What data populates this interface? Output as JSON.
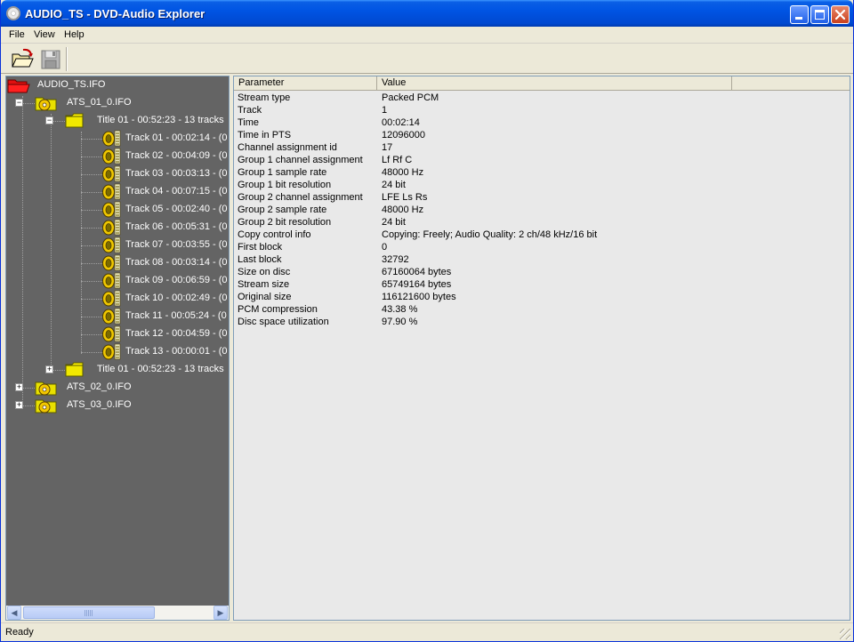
{
  "window": {
    "title": "AUDIO_TS - DVD-Audio Explorer",
    "accent": "#0054e3"
  },
  "menu": {
    "file": "File",
    "view": "View",
    "help": "Help"
  },
  "toolbar": {
    "open_icon": "open-folder-icon",
    "save_icon": "save-disk-icon"
  },
  "tree": {
    "root": "AUDIO_TS.IFO",
    "ats1": "ATS_01_0.IFO",
    "title1": "Title 01 - 00:52:23 - 13 tracks",
    "tracks": [
      "Track 01 - 00:02:14 - (0",
      "Track 02 - 00:04:09 - (0",
      "Track 03 - 00:03:13 - (0",
      "Track 04 - 00:07:15 - (0",
      "Track 05 - 00:02:40 - (0",
      "Track 06 - 00:05:31 - (0",
      "Track 07 - 00:03:55 - (0",
      "Track 08 - 00:03:14 - (0",
      "Track 09 - 00:06:59 - (0",
      "Track 10 - 00:02:49 - (0",
      "Track 11 - 00:05:24 - (0",
      "Track 12 - 00:04:59 - (0",
      "Track 13 - 00:00:01 - (0"
    ],
    "title2": "Title 01 - 00:52:23 - 13 tracks",
    "ats2": "ATS_02_0.IFO",
    "ats3": "ATS_03_0.IFO",
    "expand_glyph": "+",
    "collapse_glyph": "−"
  },
  "list": {
    "columns": [
      "Parameter",
      "Value"
    ],
    "rows": [
      [
        "Stream type",
        "Packed PCM"
      ],
      [
        "Track",
        "1"
      ],
      [
        "Time",
        "00:02:14"
      ],
      [
        "Time in PTS",
        "12096000"
      ],
      [
        "Channel assignment id",
        "17"
      ],
      [
        "Group 1 channel assignment",
        "Lf Rf C"
      ],
      [
        "Group 1 sample rate",
        "48000 Hz"
      ],
      [
        "Group 1 bit resolution",
        "24 bit"
      ],
      [
        "Group 2 channel assignment",
        "LFE Ls Rs"
      ],
      [
        "Group 2 sample rate",
        "48000 Hz"
      ],
      [
        "Group 2 bit resolution",
        "24 bit"
      ],
      [
        "Copy control info",
        "Copying: Freely; Audio Quality: 2 ch/48 kHz/16 bit"
      ],
      [
        "First block",
        "0"
      ],
      [
        "Last block",
        "32792"
      ],
      [
        "Size on disc",
        "67160064 bytes"
      ],
      [
        "Stream size",
        "65749164 bytes"
      ],
      [
        "Original size",
        "116121600 bytes"
      ],
      [
        "PCM compression",
        "43.38 %"
      ],
      [
        "Disc space utilization",
        "97.90 %"
      ]
    ]
  },
  "status": {
    "text": "Ready"
  }
}
